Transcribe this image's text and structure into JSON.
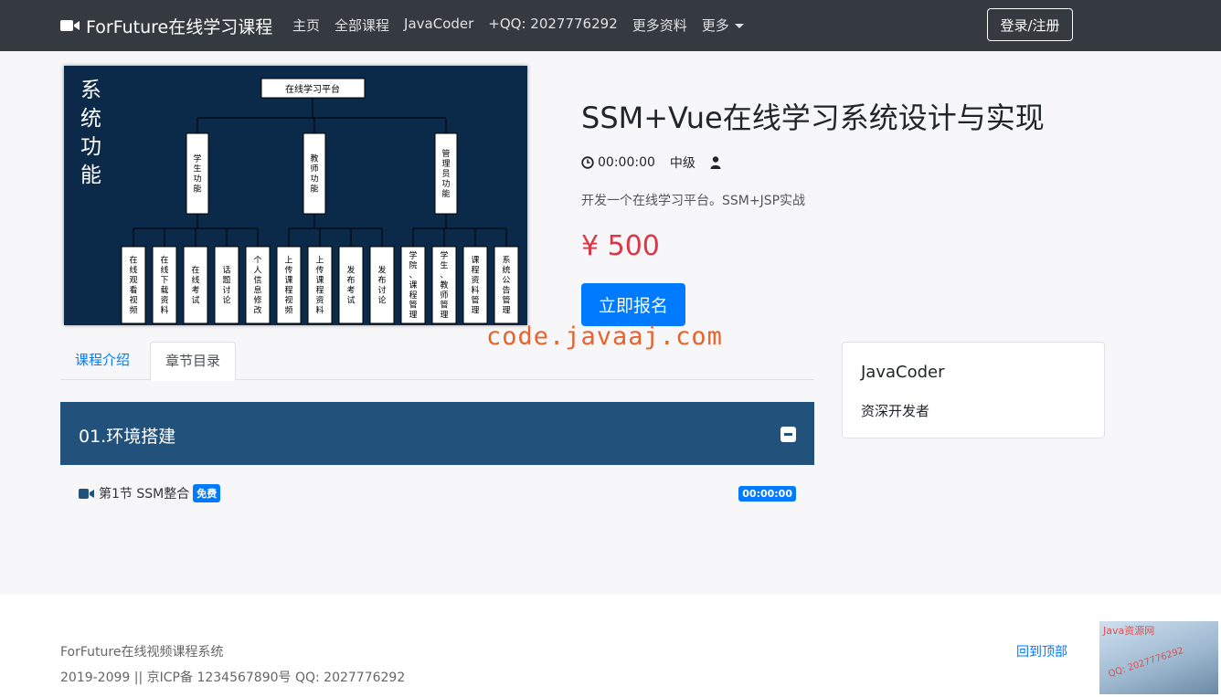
{
  "navbar": {
    "brand": "ForFuture在线学习课程",
    "links": [
      "主页",
      "全部课程",
      "JavaCoder",
      "+QQ: 2027776292",
      "更多资料",
      "更多"
    ],
    "login_label": "登录/注册",
    "brand_icon": "video-camera-icon"
  },
  "cover": {
    "side_title": [
      "系",
      "统",
      "功",
      "能"
    ],
    "root": "在线学习平台",
    "branches": [
      "学生功能",
      "教师功能",
      "管理员功能"
    ],
    "leaves": [
      "在线观看视频",
      "在线下载资料",
      "在线考试",
      "话题讨论",
      "个人信息修改",
      "上传课程视频",
      "上传课程资料",
      "发布考试",
      "发布讨论",
      "学院、课程管理",
      "学生、教师管理",
      "课程资料管理",
      "系统公告管理"
    ]
  },
  "course": {
    "title": "SSM+Vue在线学习系统设计与实现",
    "duration": "00:00:00",
    "level": "中级",
    "description": "开发一个在线学习平台。SSM+JSP实战",
    "price": "¥ 500",
    "enroll_label": "立即报名"
  },
  "watermark": "code.javaaj.com",
  "tabs": [
    "课程介绍",
    "章节目录"
  ],
  "author": {
    "name": "JavaCoder",
    "role": "资深开发者"
  },
  "chapter": {
    "title": "01.环境搭建",
    "lessons": [
      {
        "title": "第1节 SSM整合",
        "badge": "免费",
        "duration": "00:00:00"
      }
    ]
  },
  "footer": {
    "line1": "ForFuture在线视频课程系统",
    "line2": "2019-2099 || 京ICP备 1234567890号 QQ: 2027776292",
    "back_to_top": "回到顶部",
    "corner_text": "Java资源网",
    "corner_qq": "QQ: 2027776292"
  },
  "colors": {
    "navbar": "#343a40",
    "primary": "#007bff",
    "price": "#dc3545",
    "chapter": "#22527b",
    "cover_bg": "#0b2a4a"
  }
}
